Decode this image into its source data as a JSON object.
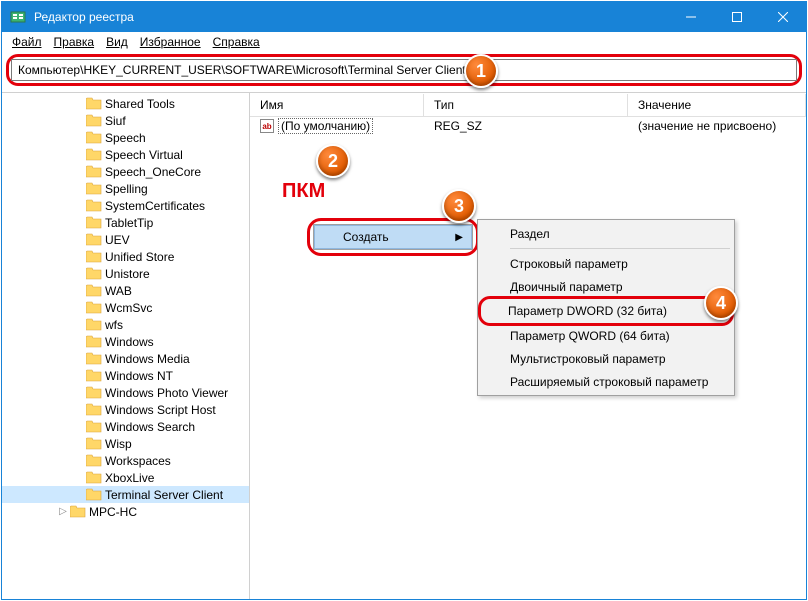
{
  "title": "Редактор реестра",
  "menubar": [
    "Файл",
    "Правка",
    "Вид",
    "Избранное",
    "Справка"
  ],
  "address": "Компьютер\\HKEY_CURRENT_USER\\SOFTWARE\\Microsoft\\Terminal Server Client",
  "columns": {
    "name": "Имя",
    "type": "Тип",
    "value": "Значение"
  },
  "row0": {
    "icon": "ab",
    "name": "(По умолчанию)",
    "type": "REG_SZ",
    "value": "(значение не присвоено)"
  },
  "pkm": "ПКМ",
  "ctx1": {
    "create": "Создать"
  },
  "ctx2": {
    "section": "Раздел",
    "string": "Строковый параметр",
    "binary": "Двоичный параметр",
    "dword": "Параметр DWORD (32 бита)",
    "qword": "Параметр QWORD (64 бита)",
    "multi": "Мультистроковый параметр",
    "expand": "Расширяемый строковый параметр"
  },
  "markers": {
    "m1": "1",
    "m2": "2",
    "m3": "3",
    "m4": "4"
  },
  "tree": [
    {
      "indent": 68,
      "exp": "",
      "label": "Shared Tools"
    },
    {
      "indent": 68,
      "exp": "",
      "label": "Siuf"
    },
    {
      "indent": 68,
      "exp": "",
      "label": "Speech"
    },
    {
      "indent": 68,
      "exp": "",
      "label": "Speech Virtual"
    },
    {
      "indent": 68,
      "exp": "",
      "label": "Speech_OneCore"
    },
    {
      "indent": 68,
      "exp": "",
      "label": "Spelling"
    },
    {
      "indent": 68,
      "exp": "",
      "label": "SystemCertificates"
    },
    {
      "indent": 68,
      "exp": "",
      "label": "TabletTip"
    },
    {
      "indent": 68,
      "exp": "",
      "label": "UEV"
    },
    {
      "indent": 68,
      "exp": "",
      "label": "Unified Store"
    },
    {
      "indent": 68,
      "exp": "",
      "label": "Unistore"
    },
    {
      "indent": 68,
      "exp": "",
      "label": "WAB"
    },
    {
      "indent": 68,
      "exp": "",
      "label": "WcmSvc"
    },
    {
      "indent": 68,
      "exp": "",
      "label": "wfs"
    },
    {
      "indent": 68,
      "exp": "",
      "label": "Windows"
    },
    {
      "indent": 68,
      "exp": "",
      "label": "Windows Media"
    },
    {
      "indent": 68,
      "exp": "",
      "label": "Windows NT"
    },
    {
      "indent": 68,
      "exp": "",
      "label": "Windows Photo Viewer"
    },
    {
      "indent": 68,
      "exp": "",
      "label": "Windows Script Host"
    },
    {
      "indent": 68,
      "exp": "",
      "label": "Windows Search"
    },
    {
      "indent": 68,
      "exp": "",
      "label": "Wisp"
    },
    {
      "indent": 68,
      "exp": "",
      "label": "Workspaces"
    },
    {
      "indent": 68,
      "exp": "",
      "label": "XboxLive"
    },
    {
      "indent": 68,
      "exp": "",
      "label": "Terminal Server Client",
      "selected": true
    },
    {
      "indent": 52,
      "exp": ">",
      "label": "MPC-HC"
    }
  ]
}
